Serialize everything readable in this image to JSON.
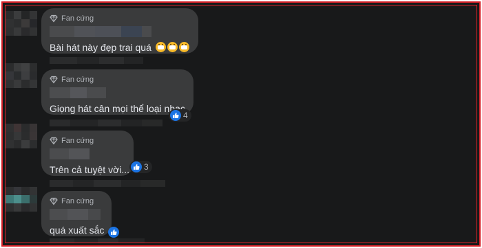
{
  "comments": [
    {
      "badge": "Fan cứng",
      "text": "Bài hát này đẹp trai quá",
      "emoji_count": 3
    },
    {
      "badge": "Fan cứng",
      "text": "Giọng hát cân mọi thể loại nhạc",
      "reaction_icon": "like-icon",
      "reaction_count": "4"
    },
    {
      "badge": "Fan cứng",
      "text": "Trên cả tuyệt vời...",
      "reaction_icon": "like-icon",
      "reaction_count": "3"
    },
    {
      "badge": "Fan cứng",
      "text": "quá xuất sắc",
      "reaction_icon": "like-icon"
    }
  ],
  "colors": {
    "background": "#18191a",
    "bubble": "#3a3b3c",
    "text": "#e4e6eb",
    "muted": "#b0b3b8",
    "like_blue": "#1b74e4",
    "frame_border": "#d8232a"
  }
}
